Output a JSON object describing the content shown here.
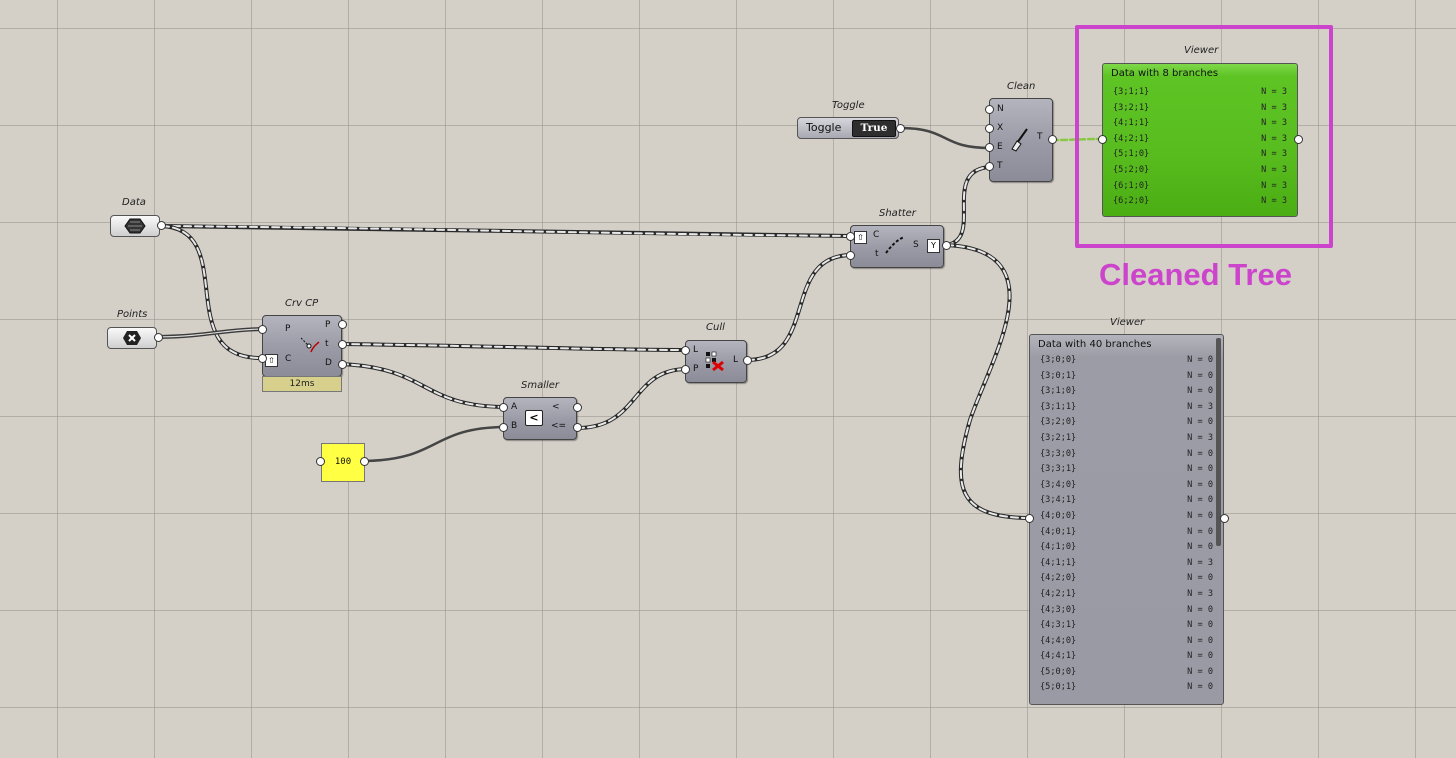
{
  "annotation": {
    "label": "Cleaned Tree",
    "color": "#cc44cc"
  },
  "components": {
    "data_param": {
      "caption": "Data"
    },
    "points_param": {
      "caption": "Points"
    },
    "crv_cp": {
      "caption": "Crv CP",
      "inputs": [
        "P",
        "C"
      ],
      "outputs": [
        "P",
        "t",
        "D"
      ],
      "timing": "12ms"
    },
    "number_panel": {
      "value": "100"
    },
    "smaller": {
      "caption": "Smaller",
      "inputs": [
        "A",
        "B"
      ],
      "outputs": [
        "<",
        "<="
      ],
      "icon_text": "<"
    },
    "cull": {
      "caption": "Cull",
      "inputs": [
        "L",
        "P"
      ],
      "outputs": [
        "L"
      ]
    },
    "shatter": {
      "caption": "Shatter",
      "inputs": [
        "C",
        "t"
      ],
      "outputs": [
        "S"
      ]
    },
    "toggle": {
      "caption": "Toggle",
      "label": "Toggle",
      "value": "True"
    },
    "clean": {
      "caption": "Clean",
      "inputs": [
        "N",
        "X",
        "E",
        "T"
      ],
      "outputs": [
        "T"
      ]
    }
  },
  "viewer_top": {
    "caption": "Viewer",
    "title": "Data with 8 branches",
    "rows": [
      {
        "path": "{3;1;1}",
        "count": "N = 3"
      },
      {
        "path": "{3;2;1}",
        "count": "N = 3"
      },
      {
        "path": "{4;1;1}",
        "count": "N = 3"
      },
      {
        "path": "{4;2;1}",
        "count": "N = 3"
      },
      {
        "path": "{5;1;0}",
        "count": "N = 3"
      },
      {
        "path": "{5;2;0}",
        "count": "N = 3"
      },
      {
        "path": "{6;1;0}",
        "count": "N = 3"
      },
      {
        "path": "{6;2;0}",
        "count": "N = 3"
      }
    ]
  },
  "viewer_bottom": {
    "caption": "Viewer",
    "title": "Data with 40 branches",
    "rows": [
      {
        "path": "{3;0;0}",
        "count": "N = 0"
      },
      {
        "path": "{3;0;1}",
        "count": "N = 0"
      },
      {
        "path": "{3;1;0}",
        "count": "N = 0"
      },
      {
        "path": "{3;1;1}",
        "count": "N = 3"
      },
      {
        "path": "{3;2;0}",
        "count": "N = 0"
      },
      {
        "path": "{3;2;1}",
        "count": "N = 3"
      },
      {
        "path": "{3;3;0}",
        "count": "N = 0"
      },
      {
        "path": "{3;3;1}",
        "count": "N = 0"
      },
      {
        "path": "{3;4;0}",
        "count": "N = 0"
      },
      {
        "path": "{3;4;1}",
        "count": "N = 0"
      },
      {
        "path": "{4;0;0}",
        "count": "N = 0"
      },
      {
        "path": "{4;0;1}",
        "count": "N = 0"
      },
      {
        "path": "{4;1;0}",
        "count": "N = 0"
      },
      {
        "path": "{4;1;1}",
        "count": "N = 3"
      },
      {
        "path": "{4;2;0}",
        "count": "N = 0"
      },
      {
        "path": "{4;2;1}",
        "count": "N = 3"
      },
      {
        "path": "{4;3;0}",
        "count": "N = 0"
      },
      {
        "path": "{4;3;1}",
        "count": "N = 0"
      },
      {
        "path": "{4;4;0}",
        "count": "N = 0"
      },
      {
        "path": "{4;4;1}",
        "count": "N = 0"
      },
      {
        "path": "{5;0;0}",
        "count": "N = 0"
      },
      {
        "path": "{5;0;1}",
        "count": "N = 0"
      }
    ]
  },
  "colors": {
    "canvas": "#d4d0c8",
    "component": "#a0a0ac",
    "viewer_green": "#5ec424",
    "viewer_gray": "#9c9ca6",
    "panel_yellow": "#ffff44",
    "highlight": "#cc44cc",
    "wire": "#454545",
    "wire_green": "#88c844"
  }
}
